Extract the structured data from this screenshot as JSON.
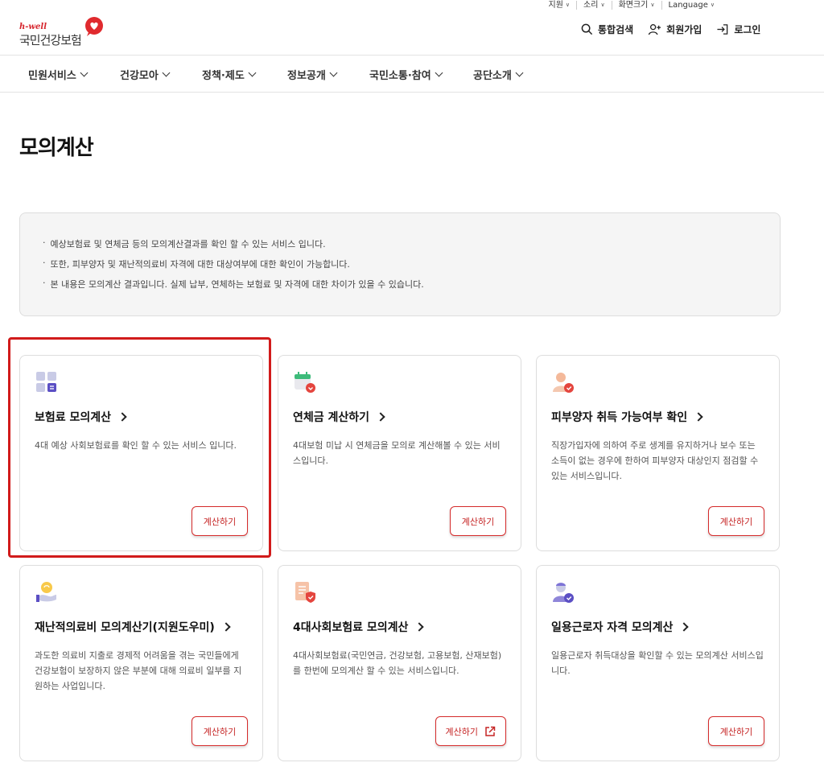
{
  "utility": [
    {
      "label": "지원"
    },
    {
      "label": "소리"
    },
    {
      "label": "화면크기"
    },
    {
      "label": "Language"
    }
  ],
  "logo": {
    "en": "h-well",
    "ko": "국민건강보험"
  },
  "top_actions": {
    "search": "통합검색",
    "signup": "회원가입",
    "login": "로그인"
  },
  "nav": [
    "민원서비스",
    "건강모아",
    "정책·제도",
    "정보공개",
    "국민소통·참여",
    "공단소개"
  ],
  "page_title": "모의계산",
  "info_lines": [
    "예상보험료 및 연체금 등의 모의계산결과를 확인 할 수 있는 서비스 입니다.",
    "또한, 피부양자 및 재난적의료비 자격에 대한 대상여부에 대한 확인이 가능합니다.",
    "본 내용은 모의계산 결과입니다. 실제 납부, 연체하는 보험료 및 자격에 대한 차이가 있을 수 있습니다."
  ],
  "cards": [
    {
      "title": "보험료 모의계산",
      "desc": "4대 예상 사회보험료를 확인 할 수 있는 서비스 입니다.",
      "button": "계산하기",
      "icon": "calculator-icon"
    },
    {
      "title": "연체금 계산하기",
      "desc": "4대보험 미납 시 연체금을 모의로 계산해볼 수 있는 서비스입니다.",
      "button": "계산하기",
      "icon": "calendar-icon"
    },
    {
      "title": "피부양자 취득 가능여부 확인",
      "desc": "직장가입자에 의하여 주로 생계를 유지하거나 보수 또는 소득이 없는 경우에 한하여 피부양자 대상인지 점검할 수 있는 서비스입니다.",
      "button": "계산하기",
      "icon": "person-check-icon"
    },
    {
      "title": "재난적의료비 모의계산기(지원도우미)",
      "desc": "과도한 의료비 지출로 경제적 어려움을 겪는 국민들에게 건강보험이 보장하지 않은 부분에 대해 의료비 일부를 지원하는 사업입니다.",
      "button": "계산하기",
      "icon": "hand-coin-icon"
    },
    {
      "title": "4대사회보험료 모의계산",
      "desc": "4대사회보험료(국민연금, 건강보험, 고용보험, 산재보험)를 한번에 모의계산 할 수 있는 서비스입니다.",
      "button": "계산하기",
      "icon": "document-shield-icon"
    },
    {
      "title": "일용근로자 자격 모의계산",
      "desc": "일용근로자 취득대상을 확인할 수 있는 모의계산 서비스입니다.",
      "button": "계산하기",
      "icon": "worker-check-icon"
    }
  ],
  "colors": {
    "accent": "#d52b2b",
    "info_bg": "#f5f5f5",
    "highlight": "#d11b1b"
  }
}
